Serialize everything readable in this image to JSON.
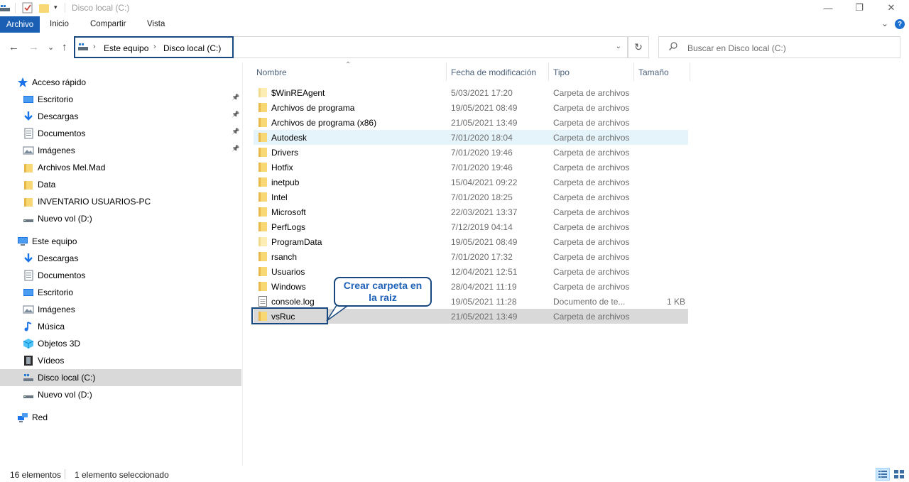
{
  "window": {
    "title": "Disco local (C:)",
    "controls": {
      "minimize": "—",
      "maximize": "❐",
      "close": "✕"
    }
  },
  "ribbon": {
    "tabs": [
      "Archivo",
      "Inicio",
      "Compartir",
      "Vista"
    ],
    "expand_glyph": "⌄",
    "help_glyph": "?"
  },
  "address": {
    "breadcrumbs": [
      "Este equipo",
      "Disco local (C:)"
    ],
    "separator": "›",
    "dropdown_glyph": "⌄",
    "refresh_glyph": "↻",
    "search_placeholder": "Buscar en Disco local (C:)"
  },
  "nav_buttons": {
    "back": "←",
    "forward": "→",
    "recent": "⌄",
    "up": "↑"
  },
  "sidebar": {
    "quick_access": {
      "label": "Acceso rápido",
      "items": [
        {
          "label": "Escritorio",
          "icon": "desktop-icon",
          "pinned": true
        },
        {
          "label": "Descargas",
          "icon": "download-icon",
          "pinned": true
        },
        {
          "label": "Documentos",
          "icon": "documents-icon",
          "pinned": true
        },
        {
          "label": "Imágenes",
          "icon": "pictures-icon",
          "pinned": true
        },
        {
          "label": "Archivos Mel.Mad",
          "icon": "folder-icon",
          "pinned": false
        },
        {
          "label": "Data",
          "icon": "folder-icon",
          "pinned": false
        },
        {
          "label": "INVENTARIO USUARIOS-PC",
          "icon": "folder-icon",
          "pinned": false
        },
        {
          "label": "Nuevo vol (D:)",
          "icon": "drive-icon",
          "pinned": false
        }
      ]
    },
    "this_pc": {
      "label": "Este equipo",
      "items": [
        {
          "label": "Descargas",
          "icon": "download-icon"
        },
        {
          "label": "Documentos",
          "icon": "documents-icon"
        },
        {
          "label": "Escritorio",
          "icon": "desktop-icon"
        },
        {
          "label": "Imágenes",
          "icon": "pictures-icon"
        },
        {
          "label": "Música",
          "icon": "music-icon"
        },
        {
          "label": "Objetos 3D",
          "icon": "objects-3d-icon"
        },
        {
          "label": "Vídeos",
          "icon": "videos-icon"
        },
        {
          "label": "Disco local (C:)",
          "icon": "system-drive-icon",
          "selected": true
        },
        {
          "label": "Nuevo vol (D:)",
          "icon": "drive-icon"
        }
      ]
    },
    "network": {
      "label": "Red"
    }
  },
  "columns": {
    "name": "Nombre",
    "modified": "Fecha de modificación",
    "type": "Tipo",
    "size": "Tamaño"
  },
  "files": [
    {
      "name": "$WinREAgent",
      "modified": "5/03/2021 17:20",
      "type": "Carpeta de archivos",
      "size": "",
      "kind": "folder-pale"
    },
    {
      "name": "Archivos de programa",
      "modified": "19/05/2021 08:49",
      "type": "Carpeta de archivos",
      "size": "",
      "kind": "folder"
    },
    {
      "name": "Archivos de programa (x86)",
      "modified": "21/05/2021 13:49",
      "type": "Carpeta de archivos",
      "size": "",
      "kind": "folder"
    },
    {
      "name": "Autodesk",
      "modified": "7/01/2020 18:04",
      "type": "Carpeta de archivos",
      "size": "",
      "kind": "folder",
      "hover": true
    },
    {
      "name": "Drivers",
      "modified": "7/01/2020 19:46",
      "type": "Carpeta de archivos",
      "size": "",
      "kind": "folder"
    },
    {
      "name": "Hotfix",
      "modified": "7/01/2020 19:46",
      "type": "Carpeta de archivos",
      "size": "",
      "kind": "folder"
    },
    {
      "name": "inetpub",
      "modified": "15/04/2021 09:22",
      "type": "Carpeta de archivos",
      "size": "",
      "kind": "folder"
    },
    {
      "name": "Intel",
      "modified": "7/01/2020 18:25",
      "type": "Carpeta de archivos",
      "size": "",
      "kind": "folder"
    },
    {
      "name": "Microsoft",
      "modified": "22/03/2021 13:37",
      "type": "Carpeta de archivos",
      "size": "",
      "kind": "folder"
    },
    {
      "name": "PerfLogs",
      "modified": "7/12/2019 04:14",
      "type": "Carpeta de archivos",
      "size": "",
      "kind": "folder"
    },
    {
      "name": "ProgramData",
      "modified": "19/05/2021 08:49",
      "type": "Carpeta de archivos",
      "size": "",
      "kind": "folder-pale"
    },
    {
      "name": "rsanch",
      "modified": "7/01/2020 17:32",
      "type": "Carpeta de archivos",
      "size": "",
      "kind": "folder"
    },
    {
      "name": "Usuarios",
      "modified": "12/04/2021 12:51",
      "type": "Carpeta de archivos",
      "size": "",
      "kind": "folder"
    },
    {
      "name": "Windows",
      "modified": "28/04/2021 11:19",
      "type": "Carpeta de archivos",
      "size": "",
      "kind": "folder"
    },
    {
      "name": "console.log",
      "modified": "19/05/2021 11:28",
      "type": "Documento de te...",
      "size": "1 KB",
      "kind": "file"
    },
    {
      "name": "vsRuc",
      "modified": "21/05/2021 13:49",
      "type": "Carpeta de archivos",
      "size": "",
      "kind": "folder",
      "selected": true
    }
  ],
  "callout": {
    "line1": "Crear carpeta en",
    "line2": "la raiz"
  },
  "status": {
    "count": "16 elementos",
    "selection": "1 elemento seleccionado"
  },
  "colors": {
    "accent": "#1a5fb4",
    "folder": "#f8d775",
    "folder_pale": "#fcedb4",
    "selected": "#d9d9d9",
    "hover": "#e5f3fb",
    "annotation": "#17487f"
  }
}
